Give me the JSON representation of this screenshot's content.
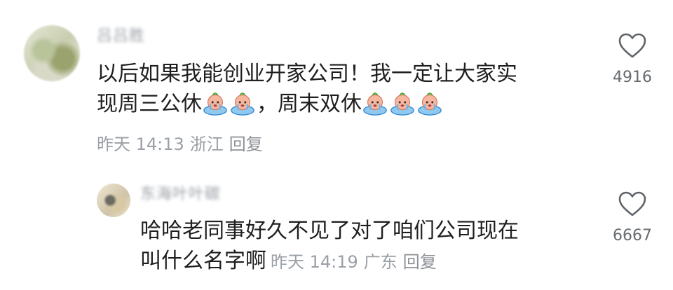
{
  "comments": [
    {
      "username": "吕吕胜",
      "text_line1": "以后如果我能创业开家公司！我一定让大家实",
      "text_line2a": "现周三公休",
      "text_line2b": "，周末双休",
      "time": "昨天 14:13",
      "location": "浙江",
      "reply_label": "回复",
      "likes": "4916",
      "emoji": "crying-face-emoji"
    },
    {
      "username": "东海叶叶碳",
      "text_line1": "哈哈老同事好久不见了对了咱们公司现在",
      "text_line2": "叫什么名字啊",
      "time": "昨天 14:19",
      "location": "广东",
      "reply_label": "回复",
      "likes": "6667"
    }
  ],
  "colors": {
    "text": "#1f1f1f",
    "meta": "#9aa0a6",
    "heart_stroke": "#5f6368"
  }
}
